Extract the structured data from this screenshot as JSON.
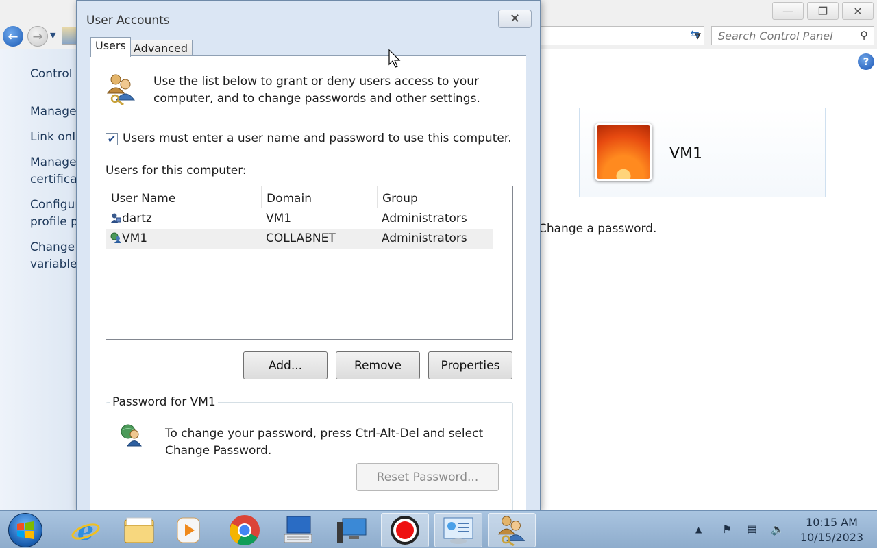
{
  "control_panel": {
    "search_placeholder": "Search Control Panel",
    "sidebar": [
      {
        "line1": "Control",
        "line2": ""
      },
      {
        "line1": "Manage",
        "line2": ""
      },
      {
        "line1": "Link onli",
        "line2": ""
      },
      {
        "line1": "Manage",
        "line2": "certificat"
      },
      {
        "line1": "Configur",
        "line2": "profile p"
      },
      {
        "line1": "Change",
        "line2": "variables"
      }
    ],
    "account_name": "VM1",
    "change_password_link": "Change a password."
  },
  "dialog": {
    "title": "User Accounts",
    "tabs": [
      {
        "label": "Users",
        "active": true
      },
      {
        "label": "Advanced",
        "active": false
      }
    ],
    "intro_text": "Use the list below to grant or deny users access to your computer, and to change passwords and other settings.",
    "login_required": {
      "checked": true,
      "label": "Users must enter a user name and password to use this computer."
    },
    "users_label": "Users for this computer:",
    "list": {
      "columns": [
        "User Name",
        "Domain",
        "Group"
      ],
      "rows": [
        {
          "user": "dartz",
          "domain": "VM1",
          "group": "Administrators"
        },
        {
          "user": "VM1",
          "domain": "COLLABNET",
          "group": "Administrators"
        }
      ]
    },
    "buttons": {
      "add": "Add...",
      "remove": "Remove",
      "properties": "Properties"
    },
    "password_group": {
      "legend": "Password for VM1",
      "text": "To change your password, press Ctrl-Alt-Del and select Change Password.",
      "reset_button": "Reset Password..."
    }
  },
  "taskbar": {
    "time": "10:15 AM",
    "date": "10/15/2023"
  }
}
